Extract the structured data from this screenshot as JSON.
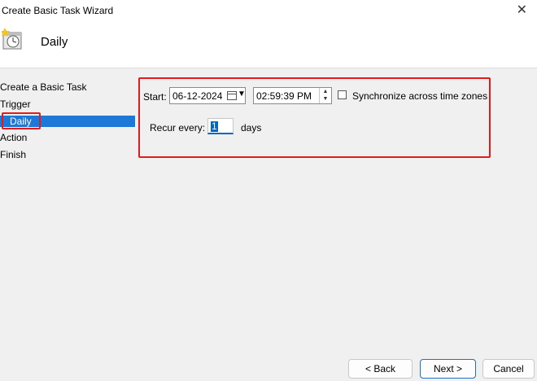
{
  "window": {
    "title": "Create Basic Task Wizard",
    "close_glyph": "✕"
  },
  "header": {
    "title": "Daily",
    "icon": "clock-calendar-icon"
  },
  "nav": {
    "items": [
      {
        "label": "Create a Basic Task",
        "selected": false
      },
      {
        "label": "Trigger",
        "selected": false
      },
      {
        "label": "Daily",
        "selected": true
      },
      {
        "label": "Action",
        "selected": false
      },
      {
        "label": "Finish",
        "selected": false
      }
    ]
  },
  "form": {
    "start_label": "Start:",
    "start_date": "06-12-2024",
    "start_time": "02:59:39 PM",
    "sync_label": "Synchronize across time zones",
    "sync_checked": false,
    "recur_label": "Recur every:",
    "recur_value": "1",
    "recur_unit": "days"
  },
  "buttons": {
    "back": "< Back",
    "next": "Next >",
    "cancel": "Cancel"
  },
  "colors": {
    "selection": "#1e78d7",
    "highlight_box": "#e31b1b",
    "primary_border": "#1e6fc8"
  }
}
